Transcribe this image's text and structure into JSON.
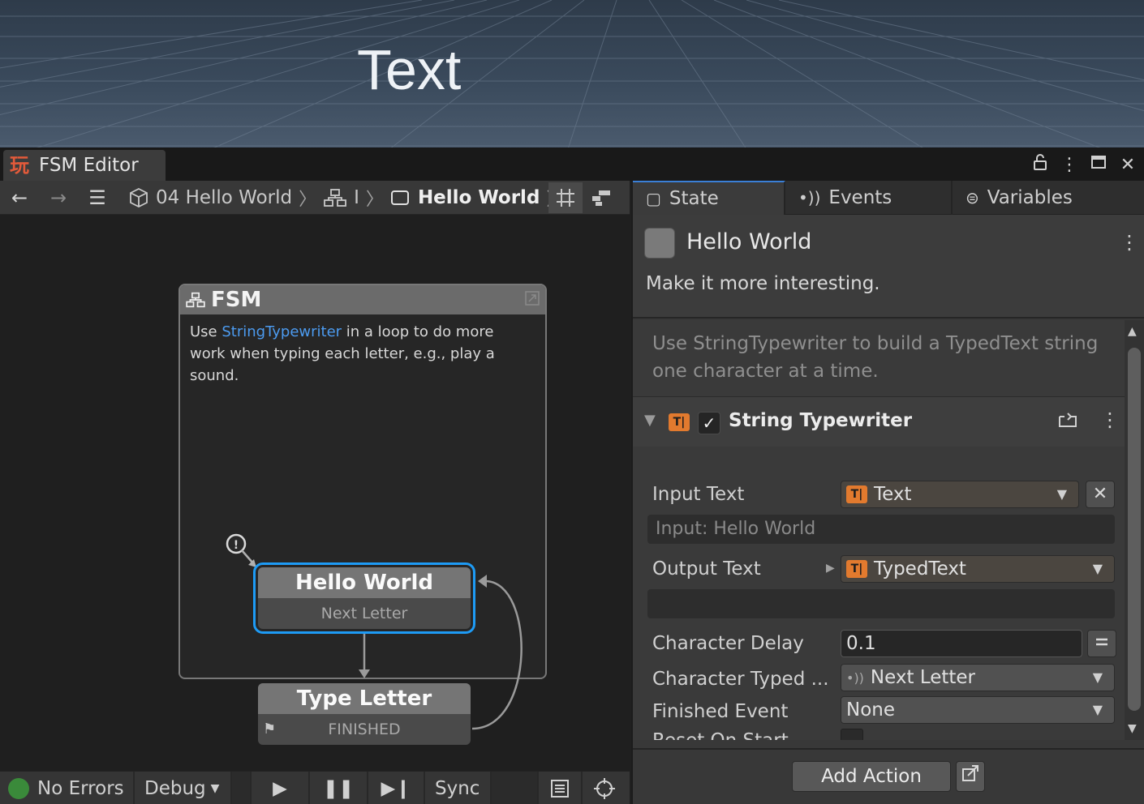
{
  "scene": {
    "text": "Text"
  },
  "window": {
    "title": "FSM Editor",
    "controls": {
      "lock": "lock-icon",
      "menu": "kebab-icon",
      "maximize": "maximize-icon",
      "close": "close-icon"
    }
  },
  "graph": {
    "breadcrumb": [
      {
        "label": "04 Hello World",
        "icon": "cube-icon"
      },
      {
        "label": "I",
        "icon": "fsm-icon"
      },
      {
        "label": "Hello World",
        "icon": "state-icon"
      }
    ],
    "fsm": {
      "title": "FSM",
      "desc_pre": "Use ",
      "desc_link": "StringTypewriter",
      "desc_post": " in a loop to do more work when typing each letter, e.g., play a sound."
    },
    "states": [
      {
        "name": "Hello World",
        "transition": "Next Letter"
      },
      {
        "name": "Type Letter",
        "transition": "FINISHED"
      }
    ],
    "status": {
      "errors": "No Errors",
      "debug": "Debug",
      "sync": "Sync"
    },
    "colors": {
      "selected": "#1e9bf5",
      "link": "#4c9bf0",
      "status_ok": "#3a8a3a"
    }
  },
  "inspector": {
    "tabs": [
      {
        "label": "State",
        "icon": "state-icon"
      },
      {
        "label": "Events",
        "icon": "event-icon"
      },
      {
        "label": "Variables",
        "icon": "variables-icon"
      }
    ],
    "state_name": "Hello World",
    "state_description": "Make it more interesting.",
    "hint": "Use StringTypewriter to build a TypedText string one character at a time.",
    "action": {
      "title": "String Typewriter",
      "enabled": true,
      "params": {
        "input_text_label": "Input Text",
        "input_text_value": "Text",
        "input_preview": "Input: Hello World",
        "output_text_label": "Output Text",
        "output_text_value": "TypedText",
        "character_delay_label": "Character Delay",
        "character_delay_value": "0.1",
        "character_typed_label": "Character Typed ...",
        "character_typed_value": "Next Letter",
        "finished_event_label": "Finished Event",
        "finished_event_value": "None",
        "reset_on_start_label": "Reset On Start"
      }
    },
    "add_action": "Add Action"
  }
}
